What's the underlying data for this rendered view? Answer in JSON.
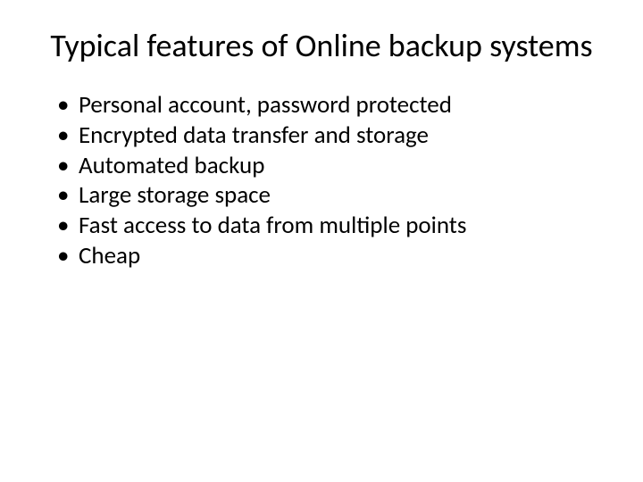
{
  "title": "Typical features of Online backup systems",
  "bullets": [
    "Personal account, password protected",
    "Encrypted data transfer and storage",
    "Automated backup",
    "Large storage space",
    "Fast access to data from multiple points",
    "Cheap"
  ]
}
